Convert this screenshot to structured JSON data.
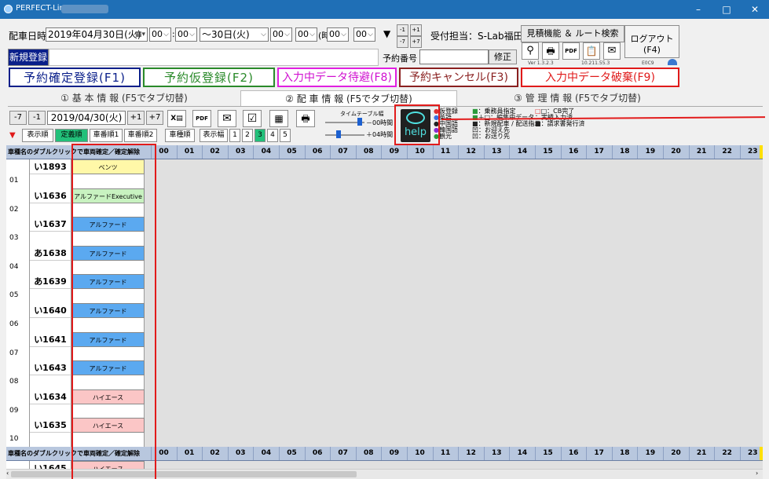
{
  "window": {
    "title": "PERFECT-Limo",
    "minimize": "–",
    "maximize": "□",
    "close": "✕"
  },
  "header": {
    "dispatch_label": "配車日時",
    "start_date": "2019年04月30日(火)",
    "start_hour": "00",
    "start_min": "00",
    "range_sep": "～30日(火)",
    "end_hour": "00",
    "end_min": "00",
    "time_label": "(時間",
    "time_hour": "00",
    "time_min": "00",
    "reception": "受付担当：S-Lab福田",
    "estimate_button": "見積機能 ＆ ルート検索",
    "logout_button": "ログアウト",
    "logout_key": "(F4)",
    "new_button": "新規登録",
    "reservation_no_label": "予約番号",
    "edit_button": "修正",
    "version": "Ver 1.3.2.3",
    "ip": "10.211.55.3",
    "code": "E0C9",
    "spin": {
      "a": "-1",
      "b": "+1",
      "c": "-7",
      "d": "+7"
    }
  },
  "actions": {
    "confirm": "予約確定登録(F1)",
    "tentative": "予約仮登録(F2)",
    "hold": "入力中データ待避(F8)",
    "cancel": "予約キャンセル(F3)",
    "discard": "入力中データ破棄(F9)"
  },
  "tabs": {
    "basic": "① 基 本 情 報 (F5でタブ切替)",
    "dispatch": "② 配 車 情 報 (F5でタブ切替)",
    "manage": "③ 管 理 情 報 (F5でタブ切替)"
  },
  "toolbar": {
    "minus7": "-7",
    "minus1": "-1",
    "date": "2019/04/30(火)",
    "plus1": "+1",
    "plus7": "+7",
    "sort_label": "表示順",
    "sort_regular": "定義順",
    "sort_car1": "車番順1",
    "sort_car2": "車番順2",
    "sort_type": "車種順",
    "width_label": "表示幅",
    "widths": [
      "1",
      "2",
      "3",
      "4",
      "5"
    ],
    "timetable_label": "タイムテーブル幅",
    "timetable_start": "－00時間",
    "timetable_end": "＋04時間",
    "help": "help"
  },
  "legend": {
    "col1": [
      "仮登録",
      "英語",
      "中国語",
      "韓国語",
      "観光"
    ],
    "col2": [
      "：乗務員指定",
      "＋□：編集中データ",
      "：新規配車 / 配送指示",
      "凹：お迎え先",
      "凹：お送り先"
    ],
    "col3": [
      "□：CB完了",
      "：実績入力済",
      "：請求書発行済"
    ],
    "colors": {
      "red": "#e03030",
      "blue": "#3a6fe0",
      "black": "#222",
      "purple": "#8a2ad0",
      "green": "#2a9a3a"
    }
  },
  "grid": {
    "header_label": "車種名のダブルクリックで車両確定／確定解除",
    "hours": [
      "00",
      "01",
      "02",
      "03",
      "04",
      "05",
      "06",
      "07",
      "08",
      "09",
      "10",
      "11",
      "12",
      "13",
      "14",
      "15",
      "16",
      "17",
      "18",
      "19",
      "20",
      "21",
      "22",
      "23"
    ],
    "rows": [
      {
        "no": "01",
        "plate": "い1893",
        "type": "ベンツ",
        "color": "#fff8a8"
      },
      {
        "no": "02",
        "plate": "い1636",
        "type": "アルファードExecutive",
        "color": "#c8f2c0"
      },
      {
        "no": "03",
        "plate": "い1637",
        "type": "アルファード",
        "color": "#5ba9f0"
      },
      {
        "no": "04",
        "plate": "あ1638",
        "type": "アルファード",
        "color": "#5ba9f0"
      },
      {
        "no": "05",
        "plate": "あ1639",
        "type": "アルファード",
        "color": "#5ba9f0"
      },
      {
        "no": "06",
        "plate": "い1640",
        "type": "アルファード",
        "color": "#5ba9f0"
      },
      {
        "no": "07",
        "plate": "い1641",
        "type": "アルファード",
        "color": "#5ba9f0"
      },
      {
        "no": "08",
        "plate": "い1643",
        "type": "アルファード",
        "color": "#5ba9f0"
      },
      {
        "no": "09",
        "plate": "い1634",
        "type": "ハイエース",
        "color": "#fbc6c6"
      },
      {
        "no": "10",
        "plate": "い1635",
        "type": "ハイエース",
        "color": "#fbc6c6"
      },
      {
        "no": "",
        "plate": "い1645",
        "type": "ハイエース",
        "color": "#fbc6c6"
      }
    ]
  }
}
